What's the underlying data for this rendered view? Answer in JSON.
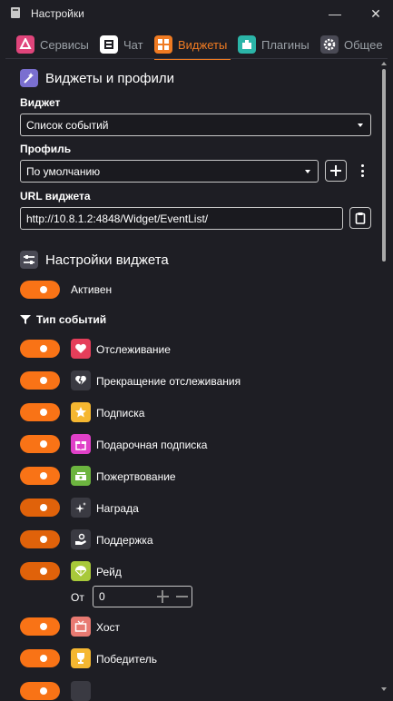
{
  "window": {
    "title": "Настройки",
    "minimize_glyph": "—",
    "close_glyph": "✕"
  },
  "tabs": [
    {
      "label": "Сервисы",
      "icon": "services-icon",
      "color": "#e0457b"
    },
    {
      "label": "Чат",
      "icon": "chat-icon",
      "color": "#4a4a55"
    },
    {
      "label": "Виджеты",
      "icon": "widgets-icon",
      "color": "#f07b22",
      "active": true
    },
    {
      "label": "Плагины",
      "icon": "plugins-icon",
      "color": "#2bb5a8"
    },
    {
      "label": "Общее",
      "icon": "gear-icon",
      "color": "#4a4a55"
    }
  ],
  "widgets_section": {
    "title": "Виджеты и профили",
    "widget_label": "Виджет",
    "widget_value": "Список событий",
    "profile_label": "Профиль",
    "profile_value": "По умолчанию",
    "url_label": "URL виджета",
    "url_value": "http://10.8.1.2:4848/Widget/EventList/"
  },
  "widget_settings": {
    "title": "Настройки виджета",
    "active_label": "Активен",
    "event_types_label": "Тип событий",
    "events": [
      {
        "label": "Отслеживание",
        "icon": "heart-icon",
        "color": "#e53e5a"
      },
      {
        "label": "Прекращение отслеживания",
        "icon": "broken-heart-icon",
        "color": "#3a3a42"
      },
      {
        "label": "Подписка",
        "icon": "star-icon",
        "color": "#f5b731"
      },
      {
        "label": "Подарочная подписка",
        "icon": "gift-icon",
        "color": "#e040c8"
      },
      {
        "label": "Пожертвование",
        "icon": "money-icon",
        "color": "#6cb43f"
      },
      {
        "label": "Награда",
        "icon": "sparkle-icon",
        "color": "#3a3a42"
      },
      {
        "label": "Поддержка",
        "icon": "support-icon",
        "color": "#3a3a42"
      },
      {
        "label": "Рейд",
        "icon": "parachute-icon",
        "color": "#a8c93a"
      },
      {
        "label": "Хост",
        "icon": "tv-icon",
        "color": "#e87a72"
      },
      {
        "label": "Победитель",
        "icon": "trophy-icon",
        "color": "#f5b731"
      }
    ],
    "raid_from_label": "От",
    "raid_from_value": "0"
  }
}
